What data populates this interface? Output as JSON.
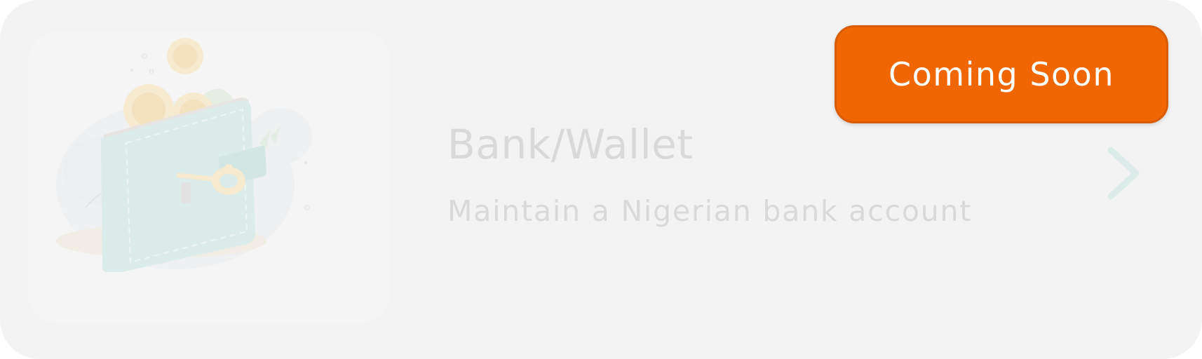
{
  "option": {
    "title": "Bank/Wallet",
    "subtitle": "Maintain a Nigerian bank account",
    "badge": "Coming Soon",
    "illustration": "wallet-with-coins-and-key",
    "chevron_icon": "chevron-right-icon"
  },
  "colors": {
    "card_background": "#f3f3f3",
    "badge_background": "#ef6602",
    "badge_text": "#ffffff",
    "muted_text": "#d9d9d9",
    "chevron": "#dcece9",
    "wallet": "#dcecea"
  }
}
